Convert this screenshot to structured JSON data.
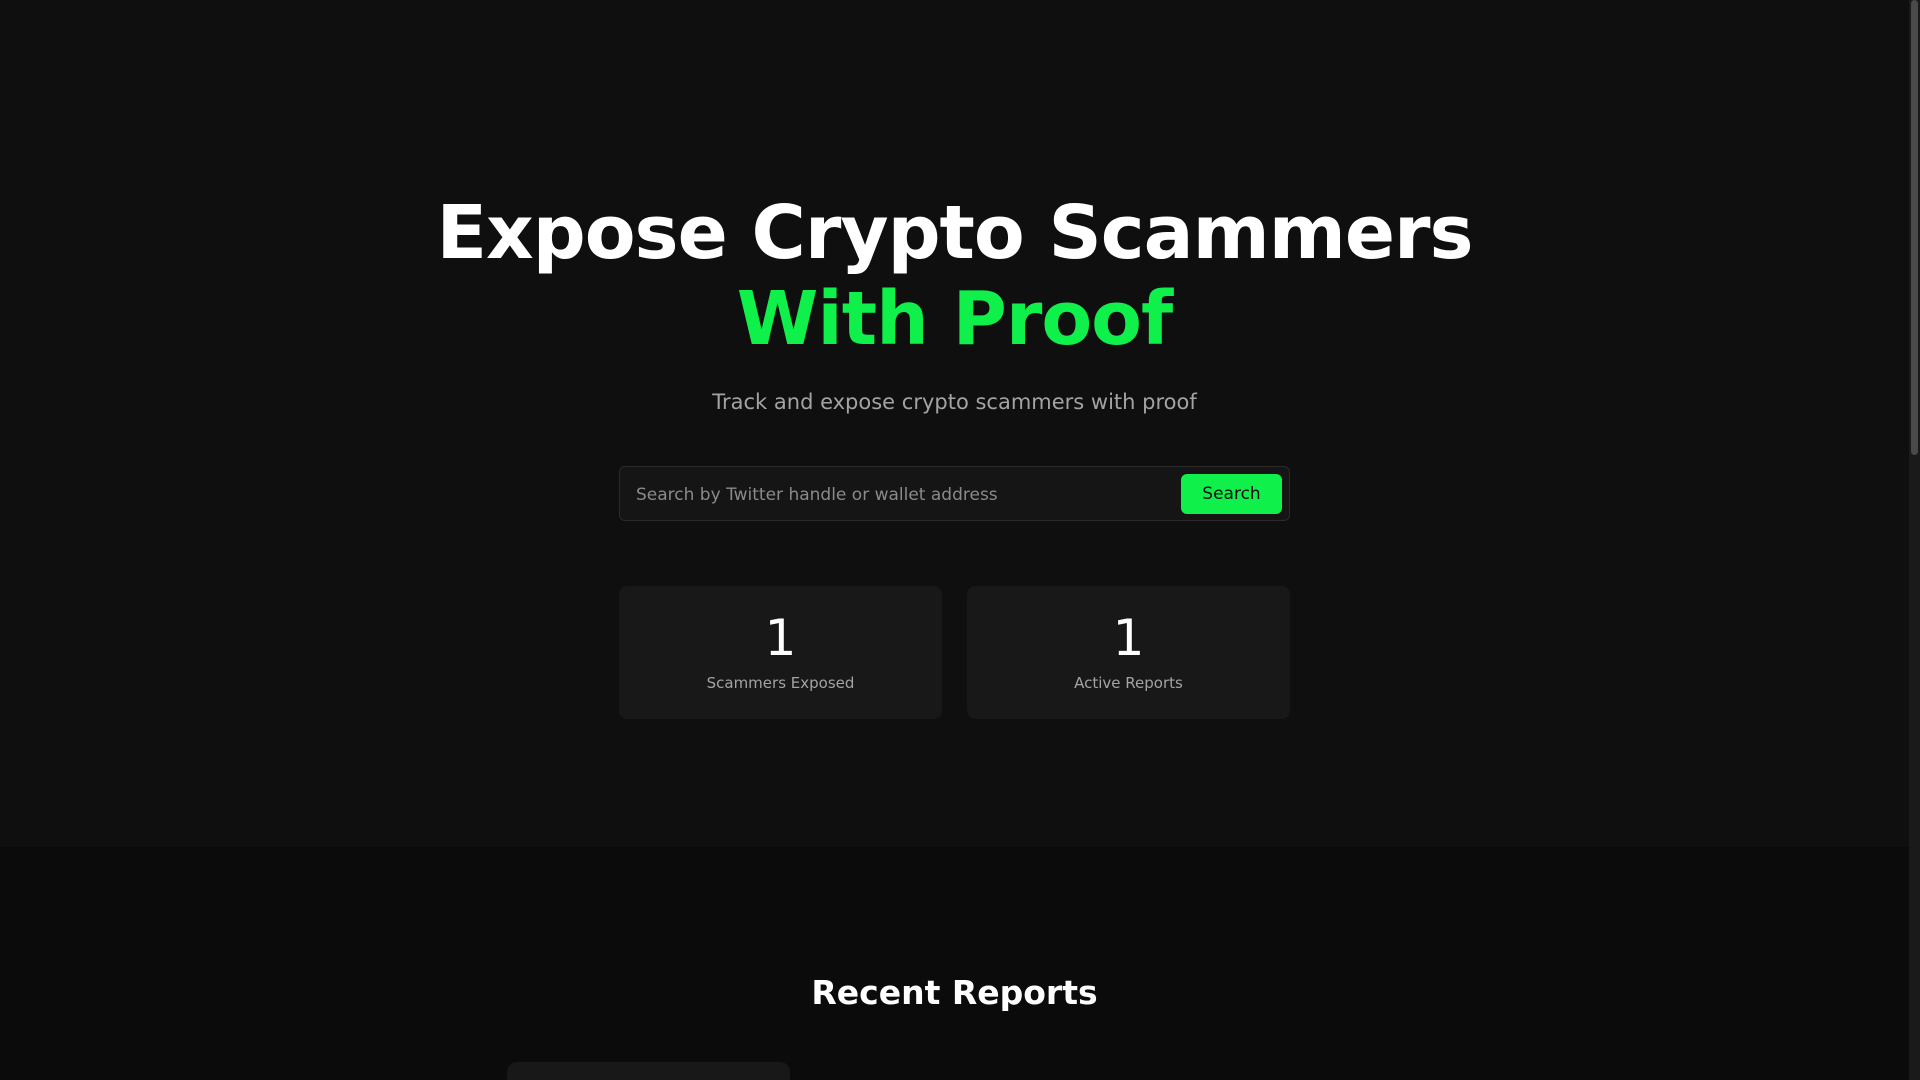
{
  "hero": {
    "headline_line1": "Expose Crypto Scammers",
    "headline_line2": "With Proof",
    "subtitle": "Track and expose crypto scammers with proof",
    "accent_color": "#10f04a"
  },
  "search": {
    "placeholder": "Search by Twitter handle or wallet address",
    "value": "",
    "button_label": "Search"
  },
  "stats": [
    {
      "value": "1",
      "label": "Scammers Exposed"
    },
    {
      "value": "1",
      "label": "Active Reports"
    }
  ],
  "recent": {
    "title": "Recent Reports"
  }
}
